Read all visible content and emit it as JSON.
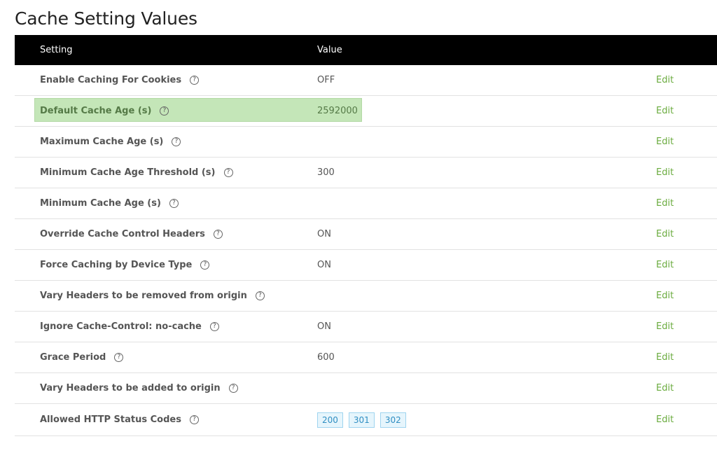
{
  "page": {
    "title": "Cache Setting Values"
  },
  "table": {
    "headers": {
      "setting": "Setting",
      "value": "Value"
    },
    "edit_label": "Edit",
    "help_glyph": "?",
    "rows": [
      {
        "setting": "Enable Caching For Cookies",
        "value": "OFF"
      },
      {
        "setting": "Default Cache Age (s)",
        "value": "2592000",
        "highlighted": true
      },
      {
        "setting": "Maximum Cache Age (s)",
        "value": ""
      },
      {
        "setting": "Minimum Cache Age Threshold (s)",
        "value": "300"
      },
      {
        "setting": "Minimum Cache Age (s)",
        "value": ""
      },
      {
        "setting": "Override Cache Control Headers",
        "value": "ON"
      },
      {
        "setting": "Force Caching by Device Type",
        "value": "ON"
      },
      {
        "setting": "Vary Headers to be removed from origin",
        "value": ""
      },
      {
        "setting": "Ignore Cache-Control: no-cache",
        "value": "ON"
      },
      {
        "setting": "Grace Period",
        "value": "600"
      },
      {
        "setting": "Vary Headers to be added to origin",
        "value": ""
      },
      {
        "setting": "Allowed HTTP Status Codes",
        "value": "",
        "codes": [
          "200",
          "301",
          "302"
        ]
      }
    ]
  },
  "colors": {
    "header_bg": "#000000",
    "highlight_bg": "#c4e6b8",
    "edit_link": "#6aab3e",
    "badge_border": "#9fd4ef",
    "badge_text": "#2f8ec2"
  },
  "icons": {
    "help": "question-circle-icon"
  }
}
